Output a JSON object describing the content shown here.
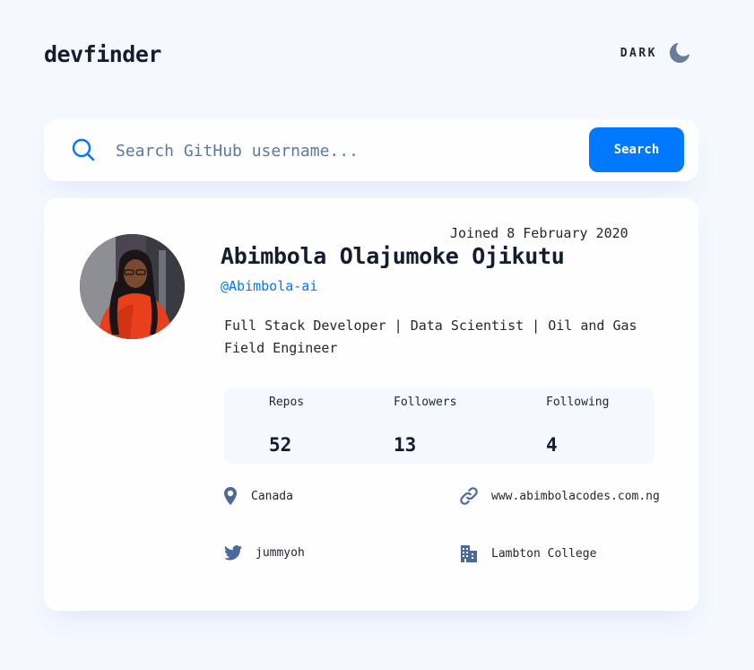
{
  "header": {
    "logo": "devfinder",
    "theme_label": "DARK",
    "theme_icon": "moon-icon"
  },
  "search": {
    "placeholder": "Search GitHub username...",
    "value": "",
    "button_label": "Search",
    "icon": "search-icon"
  },
  "profile": {
    "joined": "Joined 8 February 2020",
    "name": "Abimbola Olajumoke Ojikutu",
    "login": "@Abimbola-ai",
    "bio": "Full Stack Developer | Data Scientist | Oil and Gas Field Engineer",
    "stats": {
      "repos_label": "Repos",
      "repos": "52",
      "followers_label": "Followers",
      "followers": "13",
      "following_label": "Following",
      "following": "4"
    },
    "links": {
      "location": "Canada",
      "website": "www.abimbolacodes.com.ng",
      "twitter": "jummyoh",
      "company": "Lambton College"
    }
  },
  "colors": {
    "accent": "#0079ff",
    "background": "#f5f8ff",
    "card": "#fefefe",
    "icon": "#4b6a9b"
  }
}
